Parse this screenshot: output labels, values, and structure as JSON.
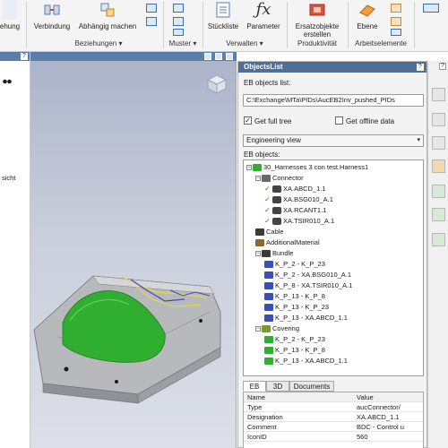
{
  "ribbon": {
    "buttons": {
      "partial_left": "ehung",
      "verbindung": "Verbindung",
      "abhaengig": "Abhängig machen",
      "stueckliste": "Stückliste",
      "parameter": "Parameter",
      "ersatzobjekte": "Ersatzobjekte erstellen",
      "ebene": "Ebene"
    },
    "groups": {
      "beziehungen": "Beziehungen ▾",
      "muster": "Muster ▾",
      "verwalten": "Verwalten ▾",
      "produktivitaet": "Produktivität",
      "arbeitselemente": "Arbeitselemente"
    },
    "icons": {
      "verbindung": "connection-icon",
      "abhaengig": "dependency-icon",
      "stueckliste": "parts-list-icon",
      "parameter": "function-fx-icon",
      "ersatzobjekte": "substitute-object-icon",
      "ebene": "plane-icon"
    }
  },
  "left_panel": {
    "help": "?",
    "text_fragment": "sicht"
  },
  "objects_list": {
    "title": "ObjectsList",
    "help": "?",
    "eb_list_label": "EB objects list:",
    "path_value": "C:\\Exchange\\MTa\\PIDs\\AucEB2Inv_pushed_PIDs",
    "get_full_tree": {
      "label": "Get full tree",
      "checked": true
    },
    "get_offline_data": {
      "label": "Get offline data",
      "checked": false
    },
    "view_select": "Engineering view",
    "eb_objects_label": "EB objects:",
    "tree": [
      {
        "label": "30_Harnesses 3 con test.Harness1",
        "level": 0,
        "type": "harness",
        "expander": "−"
      },
      {
        "label": "Connector",
        "level": 1,
        "type": "folder",
        "expander": "−"
      },
      {
        "label": "XA.ABCD_1.1",
        "level": 2,
        "type": "connector",
        "check": true
      },
      {
        "label": "XA.BSG010_A.1",
        "level": 2,
        "type": "connector",
        "check": true
      },
      {
        "label": "XA.RCANT1.1",
        "level": 2,
        "type": "connector",
        "check": true
      },
      {
        "label": "XA.TSIR010_A.1",
        "level": 2,
        "type": "connector",
        "check": true
      },
      {
        "label": "Cable",
        "level": 1,
        "type": "cable"
      },
      {
        "label": "AdditionalMaterial",
        "level": 1,
        "type": "material"
      },
      {
        "label": "Bundle",
        "level": 1,
        "type": "bundle",
        "expander": "−"
      },
      {
        "label": "K_P_2 - K_P_23",
        "level": 2,
        "type": "bundle-item"
      },
      {
        "label": "K_P_2 - XA.BSG010_A.1",
        "level": 2,
        "type": "bundle-item"
      },
      {
        "label": "K_P_8 - XA.TSIR010_A.1",
        "level": 2,
        "type": "bundle-item"
      },
      {
        "label": "K_P_13 - K_P_8",
        "level": 2,
        "type": "bundle-item"
      },
      {
        "label": "K_P_13 - K_P_23",
        "level": 2,
        "type": "bundle-item"
      },
      {
        "label": "K_P_13 - XA.ABCD_1.1",
        "level": 2,
        "type": "bundle-item"
      },
      {
        "label": "Covering",
        "level": 1,
        "type": "covering",
        "expander": "−"
      },
      {
        "label": "K_P_2 - K_P_23",
        "level": 2,
        "type": "covering-item"
      },
      {
        "label": "K_P_13 - K_P_8",
        "level": 2,
        "type": "covering-item"
      },
      {
        "label": "K_P_13 - XA.ABCD_1.1",
        "level": 2,
        "type": "covering-item"
      }
    ],
    "tabs": [
      "EB",
      "3D",
      "Documents"
    ],
    "active_tab": "EB",
    "properties": {
      "headers": [
        "Name",
        "Value"
      ],
      "rows": [
        [
          "Type",
          "aucConnector/"
        ],
        [
          "Designation",
          "XA.ABCD_1.1"
        ],
        [
          "Comment",
          "BDC - Control u"
        ],
        [
          "IconID",
          "560"
        ]
      ]
    }
  },
  "colors": {
    "panel_title": "#4f6f97",
    "harness_green": "#2fae2f",
    "check_green": "#1e9b2e",
    "viewport_top": "#aab3c8"
  }
}
